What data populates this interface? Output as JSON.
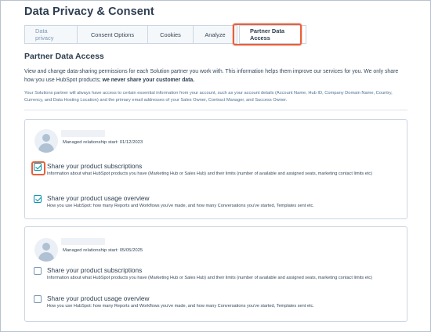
{
  "page": {
    "title": "Data Privacy & Consent"
  },
  "tabs": [
    {
      "label": "Data privacy"
    },
    {
      "label": "Consent Options"
    },
    {
      "label": "Cookies"
    },
    {
      "label": "Analyze"
    },
    {
      "label": "Partner Data Access",
      "active": true
    }
  ],
  "section": {
    "title": "Partner Data Access",
    "intro_text": "View and change data-sharing permissions for each Solution partner you work with. This information helps them improve our services for you. We only share how you use HubSpot products; ",
    "intro_bold": "we never share your customer data.",
    "note": "Your Solutions partner will always have access to certain essential information from your account, such as your account details (Account Name, Hub ID, Company Domain Name, Country, Currency, and Data Hosting Location) and the primary email addresses of your Sales Owner, Contract Manager, and Success Owner."
  },
  "partners": [
    {
      "start_text": "Managed relationship start: 01/12/2023",
      "permissions": [
        {
          "title": "Share your product subscriptions",
          "description": "Information about what HubSpot products you have (Marketing Hub or Sales Hub) and their limits (number of available and assigned seats, marketing contact limits etc)",
          "checked": true
        },
        {
          "title": "Share your product usage overview",
          "description": "How you use HubSpot: how many Reports and Workflows you've made, and how many Conversations you've started, Templates sent etc.",
          "checked": true
        }
      ]
    },
    {
      "start_text": "Managed relationship start: 05/05/2025",
      "permissions": [
        {
          "title": "Share your product subscriptions",
          "description": "Information about what HubSpot products you have (Marketing Hub or Sales Hub) and their limits (number of available and assigned seats, marketing contact limits etc)",
          "checked": false
        },
        {
          "title": "Share your product usage overview",
          "description": "How you use HubSpot: how many Reports and Workflows you've made, and how many Conversations you've started, Templates sent etc.",
          "checked": false
        }
      ]
    }
  ],
  "colors": {
    "highlight": "#e8603c",
    "accent": "#0091ae",
    "text": "#33475b"
  }
}
